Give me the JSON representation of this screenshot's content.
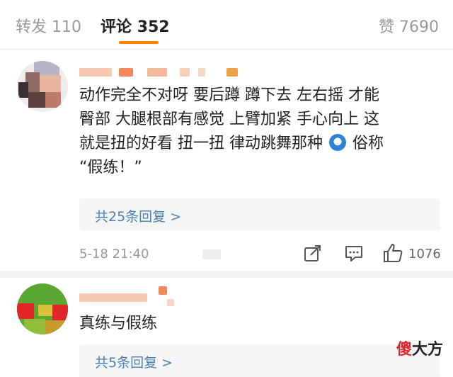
{
  "tabs": {
    "repost_label": "转发",
    "repost_count": "110",
    "comments_label": "评论",
    "comments_count": "352",
    "likes_label": "赞",
    "likes_count": "7690"
  },
  "comments": [
    {
      "text_lines": [
        "动作完全不对呀 要后蹲  蹲下去 左右摇 才能",
        "臀部 大腿根部有感觉 上臂加紧 手心向上 这",
        "就是扭的好看 扭一扭 律动跳舞那种"
      ],
      "text_tail": "俗称",
      "text_last": "“假练！”",
      "replies_label": "共25条回复 >",
      "time": "5-18 21:40",
      "like_count": "1076"
    },
    {
      "text": "真练与假练",
      "replies_label": "共5条回复 >"
    }
  ],
  "watermark": {
    "accent": "傻",
    "rest": "大方"
  },
  "icons": [
    "share-icon",
    "comment-icon",
    "thumbs-up-icon",
    "emoji-icon"
  ],
  "colors": {
    "accent": "#ff8200",
    "link": "#4a7fb5",
    "muted": "#999999"
  }
}
